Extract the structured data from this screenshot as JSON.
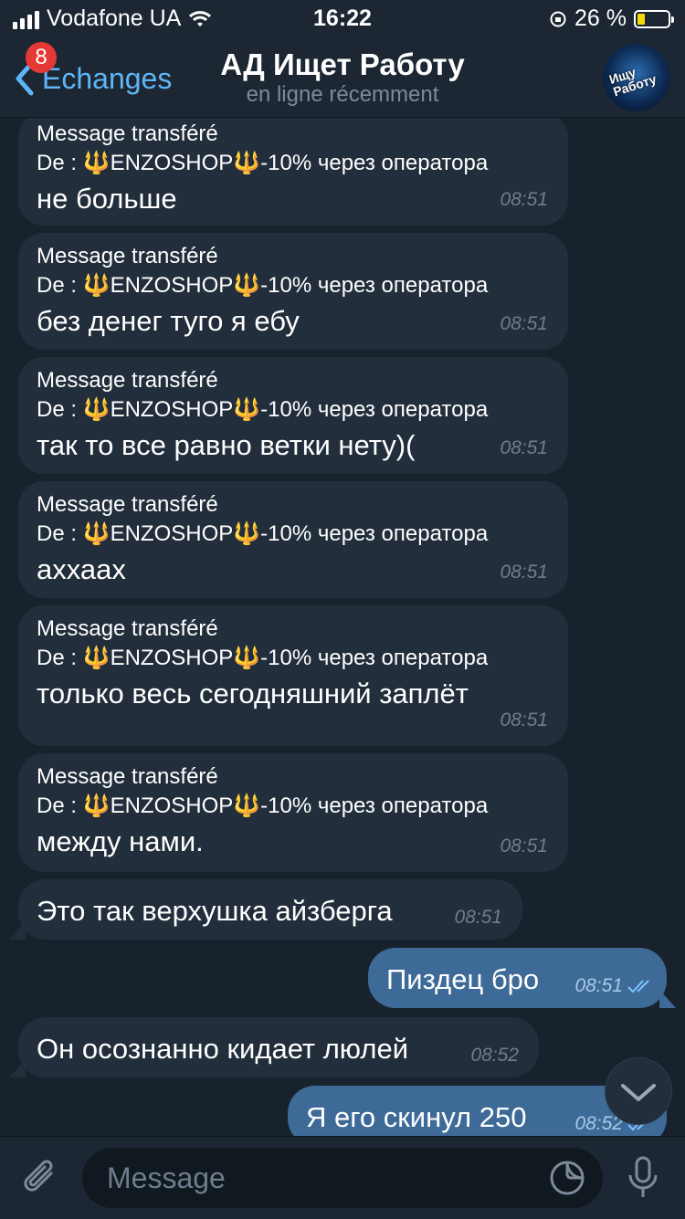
{
  "status": {
    "carrier": "Vodafone UA",
    "time": "16:22",
    "battery": "26 %",
    "battery_level": 0.26
  },
  "header": {
    "back_label": "Échanges",
    "unread_count": "8",
    "title": "АД Ищет Работу",
    "subtitle": "en ligne récemment",
    "avatar_text": "Ищу Работу"
  },
  "forwarded": {
    "label": "Message transféré",
    "prefix": "De : ",
    "source": "ENZOSHOP",
    "suffix": "-10% через оператора"
  },
  "messages": [
    {
      "text": "не больше",
      "time": "08:51"
    },
    {
      "text": "без денег туго я ебу",
      "time": "08:51"
    },
    {
      "text": "так то все равно ветки нету)(",
      "time": "08:51"
    },
    {
      "text": "аххаах",
      "time": "08:51"
    },
    {
      "text": "только весь сегодняшний заплёт",
      "time": "08:51"
    },
    {
      "text": "между нами.",
      "time": "08:51"
    },
    {
      "text": "Это так верхушка айзберга",
      "time": "08:51"
    },
    {
      "text": "Пиздец бро",
      "time": "08:51"
    },
    {
      "text": "Он осознанно кидает люлей",
      "time": "08:52"
    },
    {
      "text": "Я его скинул 250",
      "time": "08:52"
    }
  ],
  "composer": {
    "placeholder": "Message"
  },
  "colors": {
    "accent": "#5eb5f7",
    "incoming_bubble": "#222e3b",
    "outgoing_bubble": "#3d6a97",
    "background": "#18222d"
  }
}
